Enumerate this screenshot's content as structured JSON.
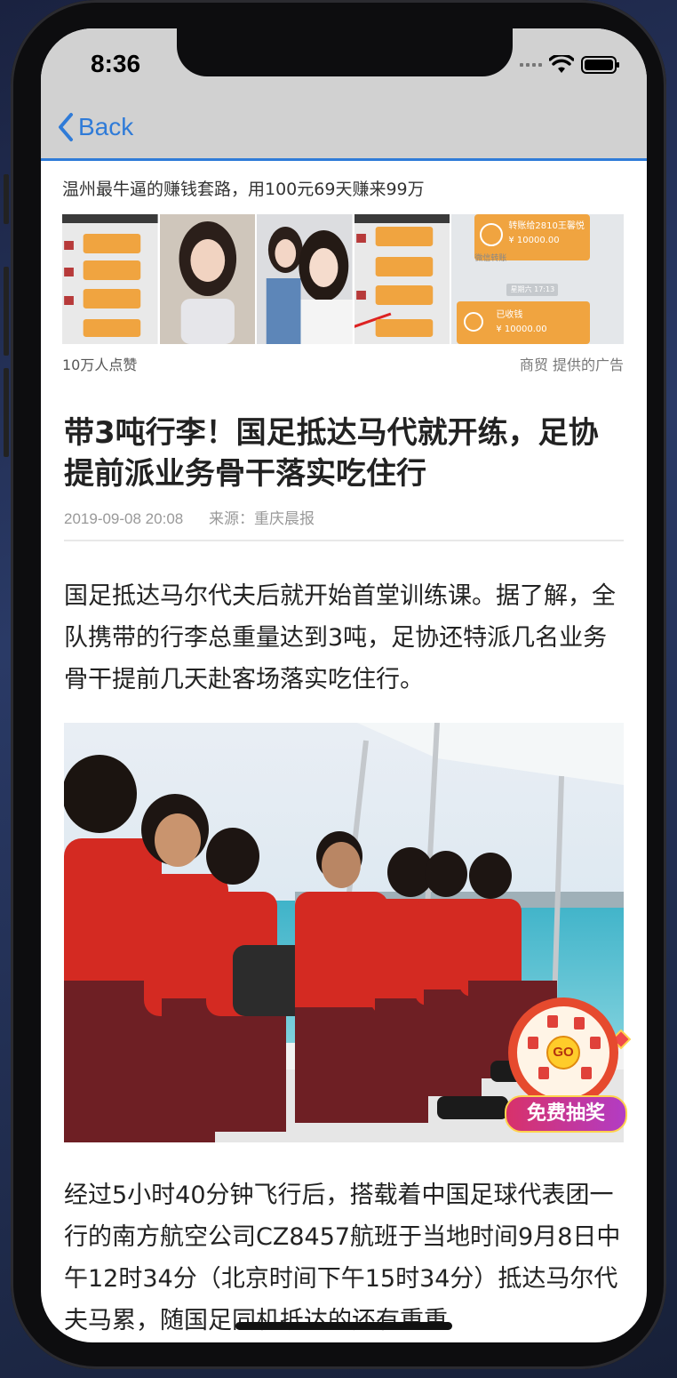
{
  "status_bar": {
    "time": "8:36"
  },
  "nav": {
    "back_label": "Back"
  },
  "ad": {
    "title": "温州最牛逼的赚钱套路，用100元69天赚来99万",
    "likes": "10万人点赞",
    "sponsor": "商贸  提供的广告",
    "payment_text": "转账给2810王馨悦",
    "payment_amount_1": "¥ 10000.00",
    "payment_wechat": "微信转账",
    "payment_time": "星期六 17:13",
    "received_text": "已收钱",
    "payment_amount_2": "¥ 10000.00"
  },
  "article": {
    "headline": "带3吨行李！国足抵达马代就开练，足协提前派业务骨干落实吃住行",
    "date": "2019-09-08 20:08",
    "source": "来源：重庆晨报",
    "paragraph_1": "国足抵达马尔代夫后就开始首堂训练课。据了解，全队携带的行李总重量达到3吨，足协还特派几名业务骨干提前几天赴客场落实吃住行。",
    "paragraph_2": "经过5小时40分钟飞行后，搭载着中国足球代表团一行的南方航空公司CZ8457航班于当地时间9月8日中午12时34分（北京时间下午15时34分）抵达马尔代夫马累，随国足同机抵达的还有重重"
  },
  "floating": {
    "lottery_label": "免费抽奖",
    "go_label": "GO"
  },
  "colors": {
    "accent": "#2f7bd8",
    "nav_bg": "#d1d1d1",
    "jersey_red": "#d42a22"
  }
}
